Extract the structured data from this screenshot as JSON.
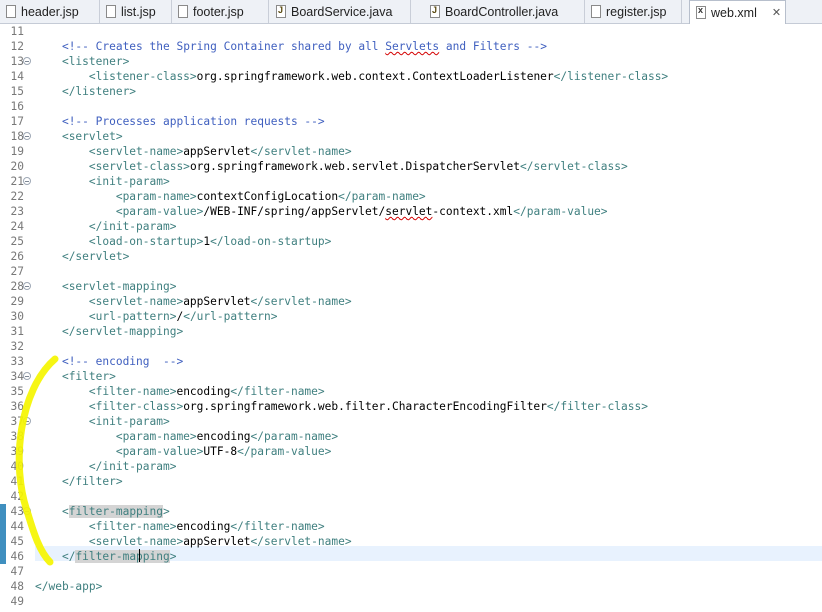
{
  "tabs": [
    {
      "label": "header.jsp",
      "icon": "jsp-file-icon",
      "active": false
    },
    {
      "label": "list.jsp",
      "icon": "jsp-file-icon",
      "active": false
    },
    {
      "label": "footer.jsp",
      "icon": "jsp-file-icon",
      "active": false
    },
    {
      "label": "BoardService.java",
      "icon": "java-file-icon",
      "active": false
    },
    {
      "label": "BoardController.java",
      "icon": "java-file-icon",
      "active": false
    },
    {
      "label": "register.jsp",
      "icon": "jsp-file-icon",
      "active": false
    },
    {
      "label": "web.xml",
      "icon": "xml-file-icon",
      "active": true
    }
  ],
  "tab_close_glyph": "✕",
  "lines": [
    {
      "n": "11",
      "fold": false,
      "segs": []
    },
    {
      "n": "12",
      "fold": false,
      "segs": [
        {
          "t": "    ",
          "c": "x"
        },
        {
          "t": "<!-- Creates the Spring Container shared by all ",
          "c": "c"
        },
        {
          "t": "Servlets",
          "c": "c squig"
        },
        {
          "t": " and Filters -->",
          "c": "c"
        }
      ]
    },
    {
      "n": "13",
      "fold": true,
      "segs": [
        {
          "t": "    ",
          "c": "x"
        },
        {
          "t": "<listener>",
          "c": "t"
        }
      ]
    },
    {
      "n": "14",
      "fold": false,
      "segs": [
        {
          "t": "        ",
          "c": "x"
        },
        {
          "t": "<listener-class>",
          "c": "t"
        },
        {
          "t": "org.springframework.web.context.ContextLoaderListener",
          "c": "x"
        },
        {
          "t": "</listener-class>",
          "c": "t"
        }
      ]
    },
    {
      "n": "15",
      "fold": false,
      "segs": [
        {
          "t": "    ",
          "c": "x"
        },
        {
          "t": "</listener>",
          "c": "t"
        }
      ]
    },
    {
      "n": "16",
      "fold": false,
      "segs": []
    },
    {
      "n": "17",
      "fold": false,
      "segs": [
        {
          "t": "    ",
          "c": "x"
        },
        {
          "t": "<!-- Processes application requests -->",
          "c": "c"
        }
      ]
    },
    {
      "n": "18",
      "fold": true,
      "segs": [
        {
          "t": "    ",
          "c": "x"
        },
        {
          "t": "<servlet>",
          "c": "t"
        }
      ]
    },
    {
      "n": "19",
      "fold": false,
      "segs": [
        {
          "t": "        ",
          "c": "x"
        },
        {
          "t": "<servlet-name>",
          "c": "t"
        },
        {
          "t": "appServlet",
          "c": "x"
        },
        {
          "t": "</servlet-name>",
          "c": "t"
        }
      ]
    },
    {
      "n": "20",
      "fold": false,
      "segs": [
        {
          "t": "        ",
          "c": "x"
        },
        {
          "t": "<servlet-class>",
          "c": "t"
        },
        {
          "t": "org.springframework.web.servlet.DispatcherServlet",
          "c": "x"
        },
        {
          "t": "</servlet-class>",
          "c": "t"
        }
      ]
    },
    {
      "n": "21",
      "fold": true,
      "segs": [
        {
          "t": "        ",
          "c": "x"
        },
        {
          "t": "<init-param>",
          "c": "t"
        }
      ]
    },
    {
      "n": "22",
      "fold": false,
      "segs": [
        {
          "t": "            ",
          "c": "x"
        },
        {
          "t": "<param-name>",
          "c": "t"
        },
        {
          "t": "contextConfigLocation",
          "c": "x"
        },
        {
          "t": "</param-name>",
          "c": "t"
        }
      ]
    },
    {
      "n": "23",
      "fold": false,
      "segs": [
        {
          "t": "            ",
          "c": "x"
        },
        {
          "t": "<param-value>",
          "c": "t"
        },
        {
          "t": "/WEB-INF/spring/appServlet/",
          "c": "x"
        },
        {
          "t": "servlet",
          "c": "x squig"
        },
        {
          "t": "-context.xml",
          "c": "x"
        },
        {
          "t": "</param-value>",
          "c": "t"
        }
      ]
    },
    {
      "n": "24",
      "fold": false,
      "segs": [
        {
          "t": "        ",
          "c": "x"
        },
        {
          "t": "</init-param>",
          "c": "t"
        }
      ]
    },
    {
      "n": "25",
      "fold": false,
      "segs": [
        {
          "t": "        ",
          "c": "x"
        },
        {
          "t": "<load-on-startup>",
          "c": "t"
        },
        {
          "t": "1",
          "c": "x"
        },
        {
          "t": "</load-on-startup>",
          "c": "t"
        }
      ]
    },
    {
      "n": "26",
      "fold": false,
      "segs": [
        {
          "t": "    ",
          "c": "x"
        },
        {
          "t": "</servlet>",
          "c": "t"
        }
      ]
    },
    {
      "n": "27",
      "fold": false,
      "segs": []
    },
    {
      "n": "28",
      "fold": true,
      "segs": [
        {
          "t": "    ",
          "c": "x"
        },
        {
          "t": "<servlet-mapping>",
          "c": "t"
        }
      ]
    },
    {
      "n": "29",
      "fold": false,
      "segs": [
        {
          "t": "        ",
          "c": "x"
        },
        {
          "t": "<servlet-name>",
          "c": "t"
        },
        {
          "t": "appServlet",
          "c": "x"
        },
        {
          "t": "</servlet-name>",
          "c": "t"
        }
      ]
    },
    {
      "n": "30",
      "fold": false,
      "segs": [
        {
          "t": "        ",
          "c": "x"
        },
        {
          "t": "<url-pattern>",
          "c": "t"
        },
        {
          "t": "/",
          "c": "x"
        },
        {
          "t": "</url-pattern>",
          "c": "t"
        }
      ]
    },
    {
      "n": "31",
      "fold": false,
      "segs": [
        {
          "t": "    ",
          "c": "x"
        },
        {
          "t": "</servlet-mapping>",
          "c": "t"
        }
      ]
    },
    {
      "n": "32",
      "fold": false,
      "segs": []
    },
    {
      "n": "33",
      "fold": false,
      "segs": [
        {
          "t": "    ",
          "c": "x"
        },
        {
          "t": "<!-- encoding  -->",
          "c": "c"
        }
      ]
    },
    {
      "n": "34",
      "fold": true,
      "segs": [
        {
          "t": "    ",
          "c": "x"
        },
        {
          "t": "<filter>",
          "c": "t"
        }
      ]
    },
    {
      "n": "35",
      "fold": false,
      "segs": [
        {
          "t": "        ",
          "c": "x"
        },
        {
          "t": "<filter-name>",
          "c": "t"
        },
        {
          "t": "encoding",
          "c": "x"
        },
        {
          "t": "</filter-name>",
          "c": "t"
        }
      ]
    },
    {
      "n": "36",
      "fold": false,
      "segs": [
        {
          "t": "        ",
          "c": "x"
        },
        {
          "t": "<filter-class>",
          "c": "t"
        },
        {
          "t": "org.springframework.web.filter.CharacterEncodingFilter",
          "c": "x"
        },
        {
          "t": "</filter-class>",
          "c": "t"
        }
      ]
    },
    {
      "n": "37",
      "fold": true,
      "segs": [
        {
          "t": "        ",
          "c": "x"
        },
        {
          "t": "<init-param>",
          "c": "t"
        }
      ]
    },
    {
      "n": "38",
      "fold": false,
      "segs": [
        {
          "t": "            ",
          "c": "x"
        },
        {
          "t": "<param-name>",
          "c": "t"
        },
        {
          "t": "encoding",
          "c": "x"
        },
        {
          "t": "</param-name>",
          "c": "t"
        }
      ]
    },
    {
      "n": "39",
      "fold": false,
      "segs": [
        {
          "t": "            ",
          "c": "x"
        },
        {
          "t": "<param-value>",
          "c": "t"
        },
        {
          "t": "UTF-8",
          "c": "x"
        },
        {
          "t": "</param-value>",
          "c": "t"
        }
      ]
    },
    {
      "n": "40",
      "fold": false,
      "segs": [
        {
          "t": "        ",
          "c": "x"
        },
        {
          "t": "</init-param>",
          "c": "t"
        }
      ]
    },
    {
      "n": "41",
      "fold": false,
      "segs": [
        {
          "t": "    ",
          "c": "x"
        },
        {
          "t": "</filter>",
          "c": "t"
        }
      ]
    },
    {
      "n": "42",
      "fold": false,
      "segs": []
    },
    {
      "n": "43",
      "fold": true,
      "segs": [
        {
          "t": "    ",
          "c": "x"
        },
        {
          "t": "<",
          "c": "t"
        },
        {
          "t": "filter-mapping",
          "c": "t hl"
        },
        {
          "t": ">",
          "c": "t"
        }
      ]
    },
    {
      "n": "44",
      "fold": false,
      "segs": [
        {
          "t": "        ",
          "c": "x"
        },
        {
          "t": "<filter-name>",
          "c": "t"
        },
        {
          "t": "encoding",
          "c": "x"
        },
        {
          "t": "</filter-name>",
          "c": "t"
        }
      ]
    },
    {
      "n": "45",
      "fold": false,
      "segs": [
        {
          "t": "        ",
          "c": "x"
        },
        {
          "t": "<servlet-name>",
          "c": "t"
        },
        {
          "t": "appServlet",
          "c": "x"
        },
        {
          "t": "</servlet-name>",
          "c": "t"
        }
      ]
    },
    {
      "n": "46",
      "fold": false,
      "segs": [
        {
          "t": "    ",
          "c": "x"
        },
        {
          "t": "</",
          "c": "t"
        },
        {
          "t": "filter-mapping",
          "c": "t hl"
        },
        {
          "t": ">",
          "c": "t"
        }
      ]
    },
    {
      "n": "47",
      "fold": false,
      "segs": []
    },
    {
      "n": "48",
      "fold": false,
      "segs": [
        {
          "t": "</web-app>",
          "c": "t"
        }
      ]
    },
    {
      "n": "49",
      "fold": false,
      "segs": []
    }
  ],
  "colors": {
    "tag": "#3f7f7f",
    "comment": "#3f5fbf",
    "text": "#000000",
    "highlighter": "#f5f500",
    "change_marker": "#3f8fbf"
  }
}
